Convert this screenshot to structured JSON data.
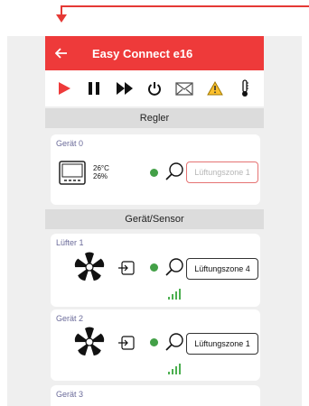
{
  "app": {
    "title": "Easy Connect e16"
  },
  "sections": {
    "controller": "Regler",
    "devices": "Gerät/Sensor"
  },
  "controller_card": {
    "title": "Gerät 0",
    "temperature": "26°C",
    "humidity": "26%",
    "zone": "Lüftungszone 1"
  },
  "devices": [
    {
      "title": "Lüfter 1",
      "zone": "Lüftungszone 4"
    },
    {
      "title": "Gerät 2",
      "zone": "Lüftungszone 1"
    },
    {
      "title": "Gerät 3"
    }
  ],
  "icons": {
    "back": "arrow-left-icon",
    "play": "play-icon",
    "pause": "pause-icon",
    "fast_forward": "fast-forward-icon",
    "power": "power-icon",
    "mail": "mail-icon",
    "warning": "warning-icon",
    "thermometer": "thermometer-icon",
    "fan": "fan-icon",
    "login": "login-icon",
    "search": "search-icon",
    "signal": "signal-icon"
  },
  "colors": {
    "accent": "#ee3a3a",
    "status_ok": "#43a047",
    "signal": "#4caf50",
    "warning": "#fbc02d"
  }
}
